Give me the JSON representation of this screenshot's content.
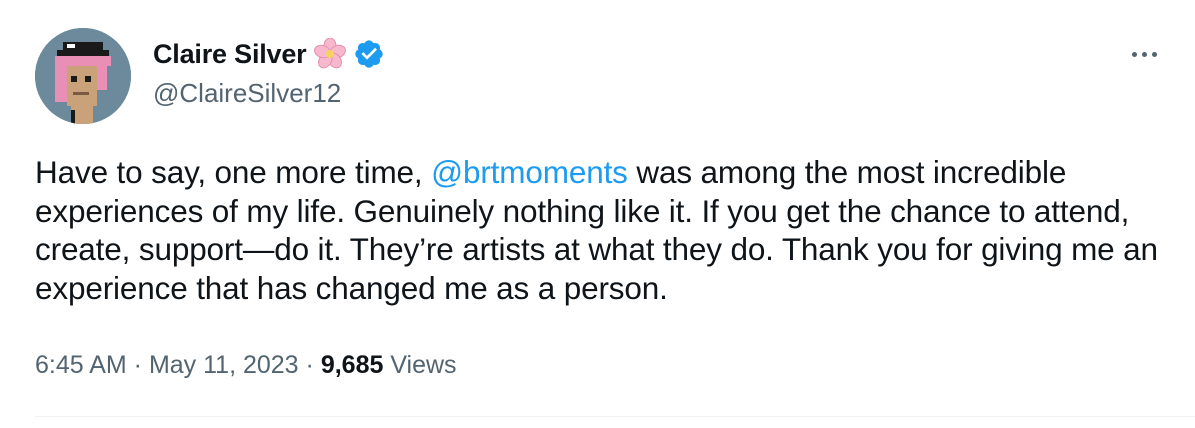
{
  "author": {
    "display_name": "Claire Silver",
    "handle": "@ClaireSilver12",
    "badges": [
      "cherry-blossom-icon",
      "verified-badge-icon"
    ],
    "verified_color": "#1d9bf0"
  },
  "tweet": {
    "text_before": "Have to say, one more time, ",
    "mention": "@brtmoments",
    "text_after": " was among the most incredible experiences of my life. Genuinely nothing like it. If you get the chance to attend, create, support—do it. They’re artists at what they do. Thank you for giving me an experience that has changed me as a person.",
    "time": "6:45 AM",
    "separator": " · ",
    "date": "May 11, 2023",
    "views_count": "9,685",
    "views_label": " Views"
  },
  "colors": {
    "link": "#1d9bf0",
    "secondary_text": "#536471",
    "primary_text": "#0f1419"
  },
  "menu": {
    "icon": "more-horizontal-icon"
  }
}
